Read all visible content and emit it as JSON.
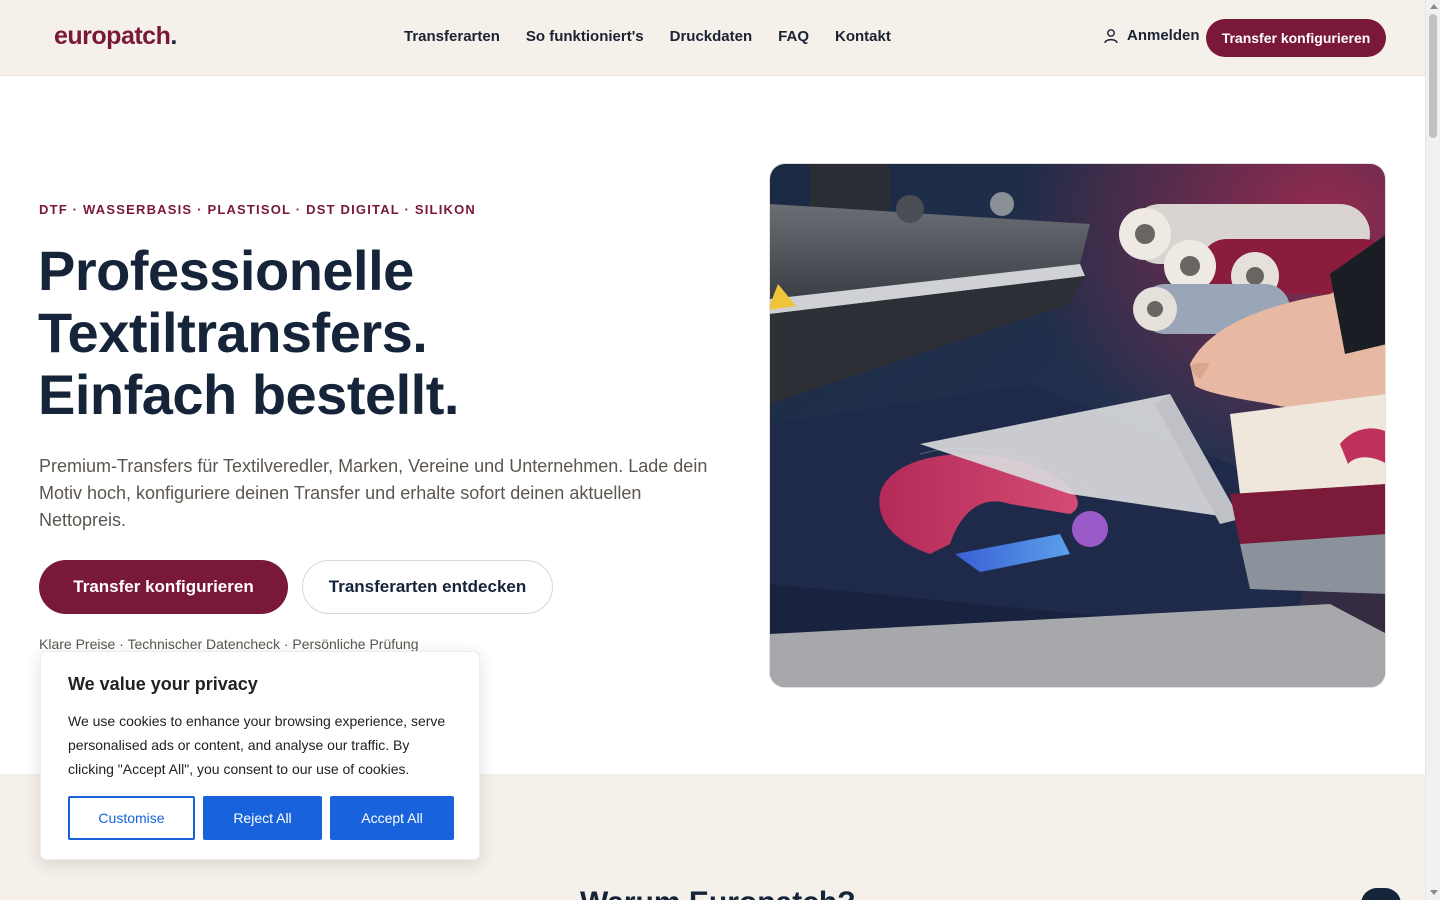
{
  "header": {
    "logo": "europatch",
    "logo_dot": ".",
    "nav": [
      "Transferarten",
      "So funktioniert's",
      "Druckdaten",
      "FAQ",
      "Kontakt"
    ],
    "login_label": "Anmelden",
    "cta_label": "Transfer konfigurieren"
  },
  "hero": {
    "eyebrow": "DTF · WASSERBASIS · PLASTISOL · DST DIGITAL · SILIKON",
    "title_lines": [
      "Professionelle",
      "Textiltransfers.",
      "Einfach bestellt."
    ],
    "subtitle": "Premium-Transfers für Textilveredler, Marken, Vereine und Unternehmen. Lade dein Motiv hoch, konfiguriere deinen Transfer und erhalte sofort deinen aktuellen Nettopreis.",
    "primary_button": "Transfer konfigurieren",
    "secondary_button": "Transferarten entdecken",
    "trust_line": "Klare Preise · Technischer Datencheck · Persönliche Prüfung"
  },
  "section": {
    "heading": "Warum Europatch?"
  },
  "cookie": {
    "title": "We value your privacy",
    "text": "We use cookies to enhance your browsing experience, serve personalised ads or content, and analyse our traffic. By clicking \"Accept All\", you consent to our use of cookies.",
    "customise": "Customise",
    "reject": "Reject All",
    "accept": "Accept All"
  },
  "colors": {
    "brand": "#7a1838",
    "navy": "#16243a",
    "cream": "#f5f0ea",
    "cookie_blue": "#1863dc"
  },
  "icons": {
    "login": "user-icon",
    "chat": "chat-icon"
  }
}
